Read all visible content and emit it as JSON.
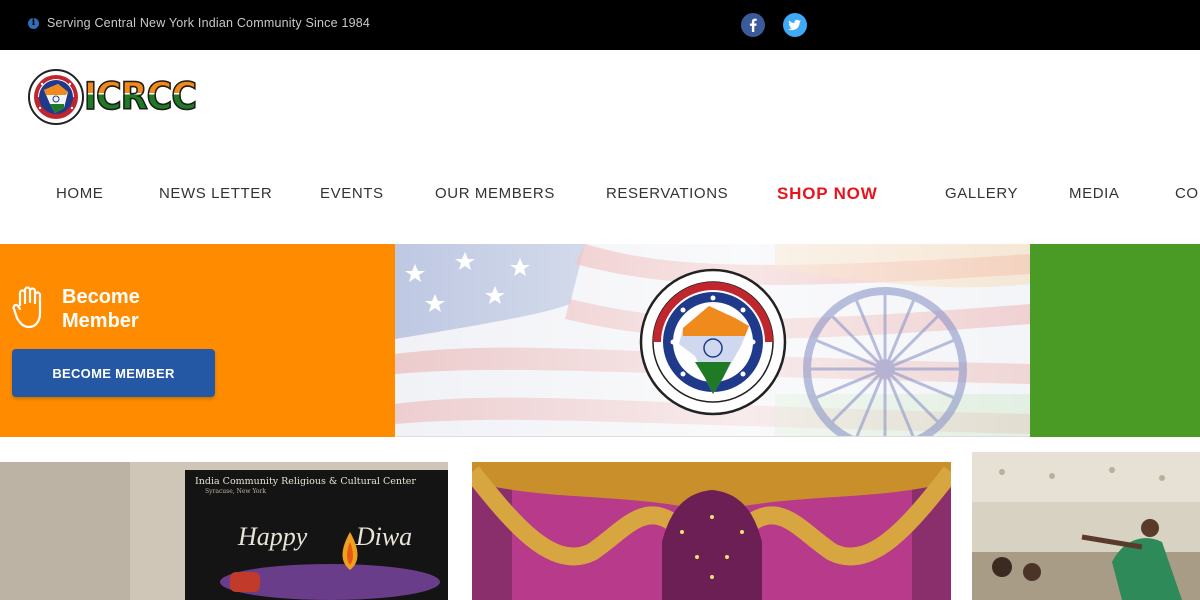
{
  "topbar": {
    "info_icon": "info-circle-icon",
    "tagline": "Serving Central New York Indian Community Since 1984",
    "social": [
      "facebook-icon",
      "twitter-icon"
    ]
  },
  "logo": {
    "text": "ICRCC"
  },
  "nav": {
    "items": [
      "HOME",
      "NEWS LETTER",
      "EVENTS",
      "OUR MEMBERS",
      "RESERVATIONS",
      "SHOP NOW",
      "GALLERY",
      "MEDIA",
      "CO"
    ]
  },
  "hero": {
    "become_title": "Become Member",
    "become_button": "BECOME MEMBER",
    "colors": {
      "orange": "#ff8c00",
      "green": "#4a9a26",
      "button": "#2458a5"
    }
  },
  "cards": {
    "diwali_banner_title": "India Community Religious & Cultural Center",
    "diwali_banner_sub": "Syracuse, New York",
    "diwali_greeting": "Happy Diwa"
  },
  "colors": {
    "shop_now": "#e8141d",
    "topbar": "#000000"
  }
}
